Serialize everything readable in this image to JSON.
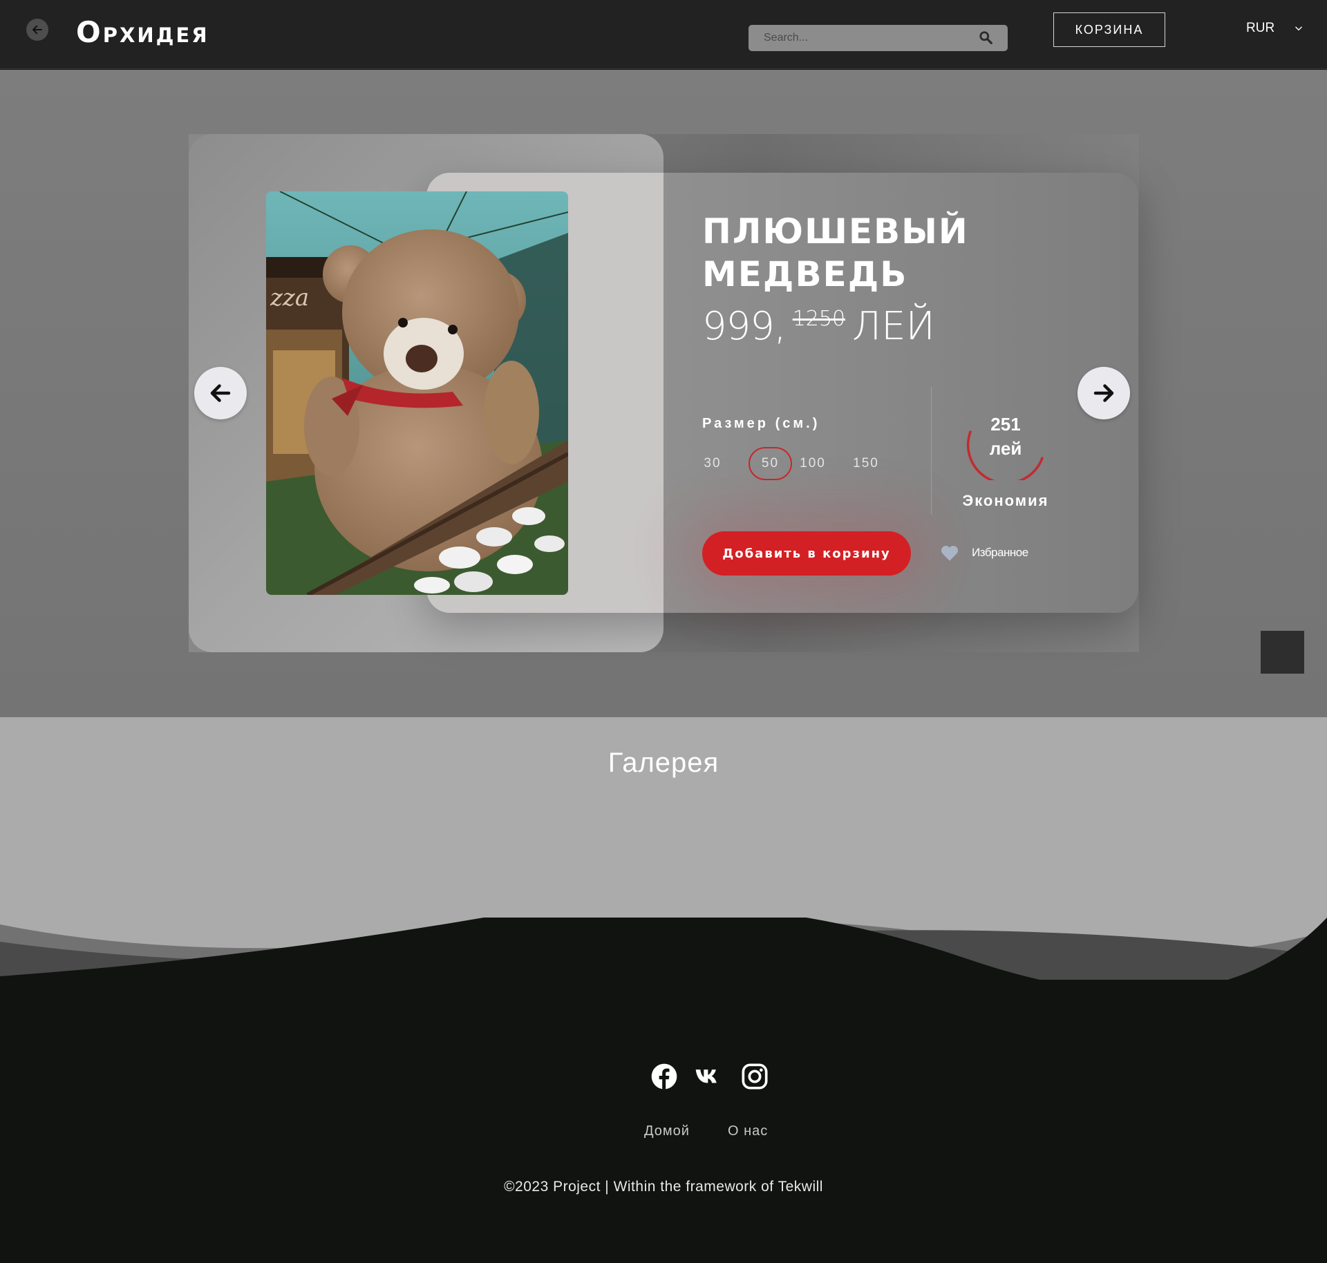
{
  "header": {
    "logo": "Орхидея",
    "search_placeholder": "Search...",
    "cart_label": "КОРЗИНА",
    "currency": "RUR"
  },
  "product": {
    "title_line1": "ПЛЮШЕВЫЙ",
    "title_line2": "МЕДВЕДЬ",
    "price": "999,",
    "old_price": "1250",
    "currency": "ЛЕЙ",
    "size_label": "Размер (см.)",
    "sizes": [
      "30",
      "50",
      "100",
      "150"
    ],
    "selected_size": "50",
    "savings_amount": "251",
    "savings_unit": "лей",
    "savings_label": "Экономия",
    "add_to_cart": "Добавить в корзину",
    "favorite": "Избранное"
  },
  "gallery": {
    "title": "Галерея"
  },
  "footer": {
    "social": [
      "facebook-icon",
      "vk-icon",
      "instagram-icon"
    ],
    "links": [
      "Домой",
      "О нас"
    ],
    "copyright": "©2023 Project | Within the framework of Tekwill"
  },
  "colors": {
    "accent": "#d32024",
    "header_bg": "#222222",
    "footer_bg": "#101310"
  }
}
